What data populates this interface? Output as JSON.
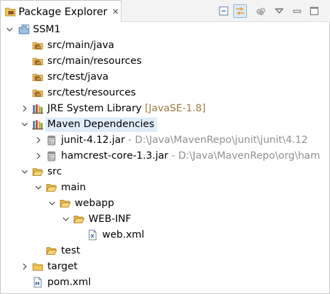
{
  "view": {
    "title": "Package Explorer",
    "close_glyph": "✕",
    "toolbar": [
      "collapse-all-icon",
      "link-with-editor-icon",
      "focus-on-active-task-icon",
      "view-menu-icon",
      "minimize-icon",
      "maximize-icon"
    ]
  },
  "tree": {
    "project": "SSM1",
    "src_main_java": "src/main/java",
    "src_main_resources": "src/main/resources",
    "src_test_java": "src/test/java",
    "src_test_resources": "src/test/resources",
    "jre": {
      "name": "JRE System Library",
      "decoration": "[JavaSE-1.8]"
    },
    "maven_deps": "Maven Dependencies",
    "junit": {
      "name": "junit-4.12.jar",
      "decoration": "- D:\\Java\\MavenRepo\\junit\\junit\\4.12"
    },
    "hamcrest": {
      "name": "hamcrest-core-1.3.jar",
      "decoration": "- D:\\Java\\MavenRepo\\org\\ham"
    },
    "src": "src",
    "main": "main",
    "webapp": "webapp",
    "webinf": "WEB-INF",
    "webxml": "web.xml",
    "test": "test",
    "target": "target",
    "pom": "pom.xml"
  },
  "colors": {
    "selection": "#dfecf9",
    "decoration": "#8f8f8f",
    "jre_decoration": "#9a7b3a",
    "folder": "#e8b94a"
  }
}
